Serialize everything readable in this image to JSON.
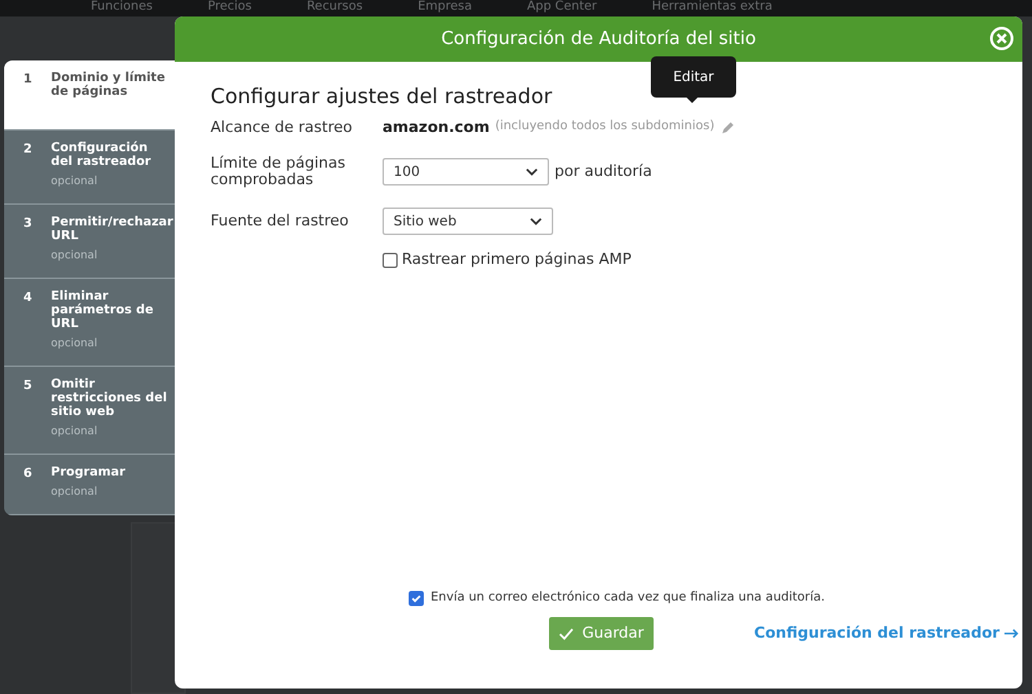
{
  "background_nav": [
    "Funciones",
    "Precios",
    "Recursos",
    "Empresa",
    "App Center",
    "Herramientas extra"
  ],
  "dialog": {
    "title": "Configuración de Auditoría del sitio"
  },
  "steps": [
    {
      "number": "1",
      "label": "Dominio y límite de páginas",
      "selected": true
    },
    {
      "number": "2",
      "label": "Configuración del rastreador",
      "note": "opcional",
      "selected": false
    },
    {
      "number": "3",
      "label": "Permitir/rechazar URL",
      "note": "opcional",
      "selected": false
    },
    {
      "number": "4",
      "label": "Eliminar parámetros de URL",
      "note": "opcional",
      "selected": false
    },
    {
      "number": "5",
      "label": "Omitir restricciones del sitio web",
      "note": "opcional",
      "selected": false
    },
    {
      "number": "6",
      "label": "Programar",
      "note": "opcional",
      "selected": false
    }
  ],
  "heading": "Configurar ajustes del rastreador",
  "scope": {
    "label": "Alcance de rastreo",
    "domain": "amazon.com",
    "hint": "(incluyendo todos los subdominios)",
    "tooltip": "Editar"
  },
  "page_limit": {
    "label": "Límite de páginas comprobadas",
    "value": "100",
    "suffix": "por auditoría"
  },
  "source": {
    "label": "Fuente del rastreo",
    "value": "Sitio web"
  },
  "amp": {
    "label": "Rastrear primero páginas AMP",
    "checked": false
  },
  "email": {
    "label": "Envía un correo electrónico cada vez que finaliza una auditoría.",
    "checked": true
  },
  "save_button": "Guardar",
  "next_link": "Configuración del rastreador"
}
